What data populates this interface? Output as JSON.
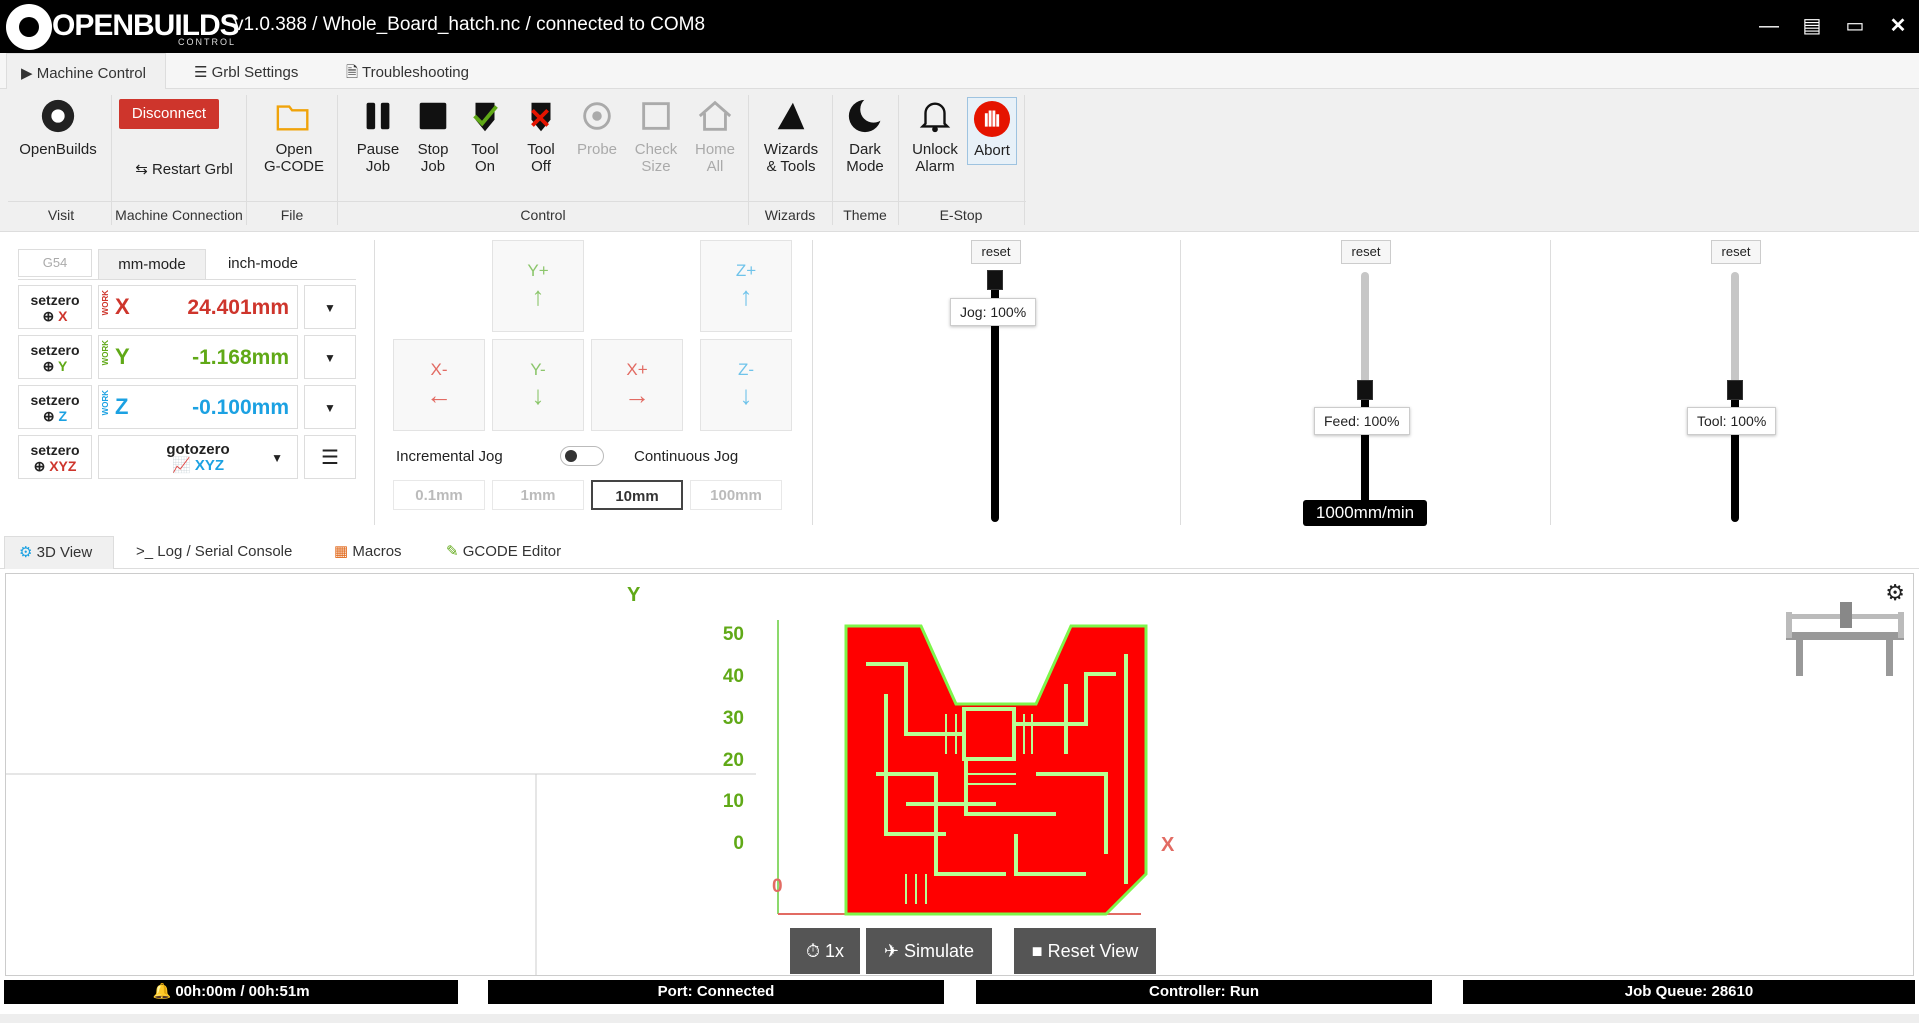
{
  "titlebar": {
    "brand": "OPENBUILDS",
    "brand_sub": "CONTROL",
    "title": "v1.0.388 / Whole_Board_hatch.nc / connected to COM8",
    "buttons": [
      "minimize-icon",
      "restore-icon",
      "fullscreen-icon",
      "close-icon"
    ]
  },
  "top_tabs": [
    {
      "label": "Machine Control",
      "icon": "play-icon",
      "active": true
    },
    {
      "label": "Grbl Settings",
      "icon": "sliders-icon"
    },
    {
      "label": "Troubleshooting",
      "icon": "file-icon"
    }
  ],
  "ribbon": {
    "visit": {
      "label": "OpenBuilds",
      "group": "Visit"
    },
    "connection": {
      "disconnect": "Disconnect",
      "restart": "Restart Grbl",
      "group": "Machine Connection"
    },
    "file": {
      "label1": "Open",
      "label2": "G-CODE",
      "group": "File"
    },
    "control": {
      "group": "Control",
      "buttons": [
        {
          "l1": "Pause",
          "l2": "Job",
          "icon": "pause-icon"
        },
        {
          "l1": "Stop",
          "l2": "Job",
          "icon": "stop-icon"
        },
        {
          "l1": "Tool",
          "l2": "On",
          "icon": "tool-on-icon"
        },
        {
          "l1": "Tool",
          "l2": "Off",
          "icon": "tool-off-icon"
        },
        {
          "l1": "Probe",
          "l2": "",
          "icon": "probe-icon"
        },
        {
          "l1": "Check",
          "l2": "Size",
          "icon": "check-size-icon"
        },
        {
          "l1": "Home",
          "l2": "All",
          "icon": "home-icon"
        }
      ]
    },
    "wizards": {
      "l1": "Wizards",
      "l2": "& Tools",
      "group": "Wizards"
    },
    "theme": {
      "l1": "Dark",
      "l2": "Mode",
      "group": "Theme"
    },
    "estop": {
      "unlock1": "Unlock",
      "unlock2": "Alarm",
      "abort": "Abort",
      "group": "E-Stop"
    }
  },
  "dro": {
    "coord": "G54",
    "modes": [
      "mm-mode",
      "inch-mode"
    ],
    "setzero": "setzero",
    "work": "WORK",
    "axes": [
      {
        "name": "X",
        "value": "24.401mm",
        "color": "#ce352c"
      },
      {
        "name": "Y",
        "value": "-1.168mm",
        "color": "#60a917"
      },
      {
        "name": "Z",
        "value": "-0.100mm",
        "color": "#1ba1e2"
      }
    ],
    "xyz": "XYZ",
    "gotozero": "gotozero"
  },
  "jog": {
    "yplus": "Y+",
    "yminus": "Y-",
    "xminus": "X-",
    "xplus": "X+",
    "zplus": "Z+",
    "zminus": "Z-",
    "incremental": "Incremental Jog",
    "continuous": "Continuous Jog",
    "steps": [
      "0.1mm",
      "1mm",
      "10mm",
      "100mm"
    ],
    "active_step": "10mm"
  },
  "overrides": [
    {
      "reset": "reset",
      "tooltip": "Jog: 100%",
      "level": 1.0
    },
    {
      "reset": "reset",
      "tooltip": "Feed: 100%",
      "level": 0.5,
      "badge": "1000mm/min"
    },
    {
      "reset": "reset",
      "tooltip": "Tool: 100%",
      "level": 0.5
    }
  ],
  "view_tabs": [
    {
      "label": "3D View",
      "icon": "cube-icon",
      "active": true
    },
    {
      "label": "Log / Serial Console",
      "icon": "terminal-icon"
    },
    {
      "label": "Macros",
      "icon": "grid-icon"
    },
    {
      "label": "GCODE Editor",
      "icon": "edit-icon"
    }
  ],
  "viewer": {
    "y_axis": "Y",
    "x_axis": "X",
    "origin": "0",
    "y_ticks": [
      "50",
      "40",
      "30",
      "20",
      "10",
      "0"
    ],
    "speed": "1x",
    "simulate": "Simulate",
    "reset_view": "Reset View"
  },
  "status": {
    "time": "00h:00m / 00h:51m",
    "port": "Port: Connected",
    "controller": "Controller: Run",
    "queue": "Job Queue: 28610"
  }
}
